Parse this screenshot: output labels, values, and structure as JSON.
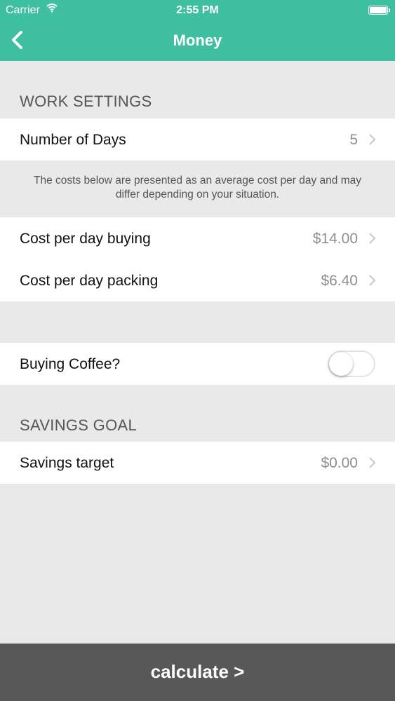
{
  "status_bar": {
    "carrier": "Carrier",
    "time": "2:55 PM"
  },
  "nav": {
    "title": "Money"
  },
  "work_settings": {
    "header": "WORK SETTINGS",
    "number_of_days": {
      "label": "Number of Days",
      "value": "5"
    },
    "note": "The costs below are presented as an average cost per day and may differ depending on your situation.",
    "cost_buying": {
      "label": "Cost per day buying",
      "value": "$14.00"
    },
    "cost_packing": {
      "label": "Cost per day packing",
      "value": "$6.40"
    }
  },
  "coffee": {
    "label": "Buying Coffee?",
    "enabled": false
  },
  "savings_goal": {
    "header": "SAVINGS GOAL",
    "target": {
      "label": "Savings target",
      "value": "$0.00"
    }
  },
  "footer": {
    "calculate_label": "calculate >"
  },
  "colors": {
    "accent": "#3ec0a0",
    "footer": "#585858",
    "background": "#e9e9ea"
  }
}
